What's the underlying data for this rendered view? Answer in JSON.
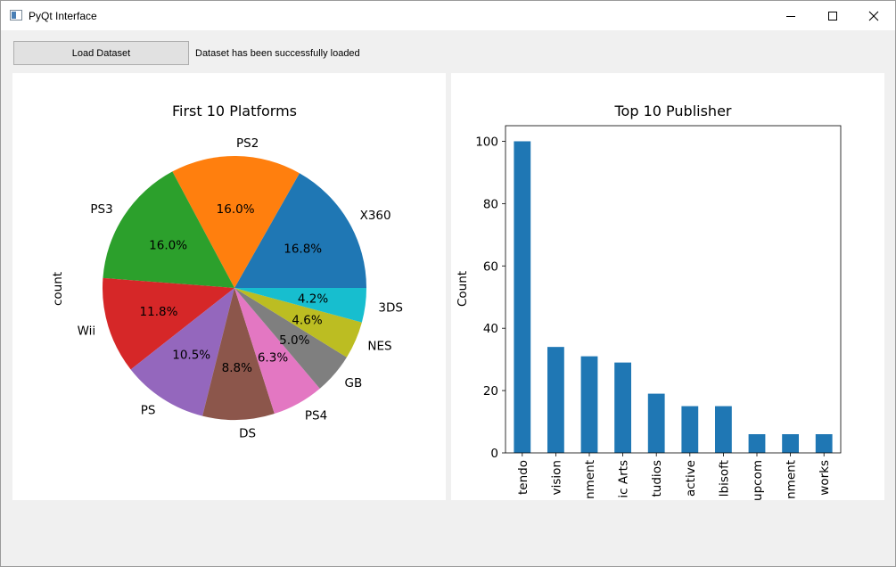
{
  "window": {
    "title": "PyQt Interface",
    "icons": {
      "app": "app-window-icon",
      "minimize": "minimize-icon",
      "maximize": "maximize-icon",
      "close": "close-icon"
    }
  },
  "toolbar": {
    "load_label": "Load Dataset",
    "status_text": "Dataset has been successfully loaded"
  },
  "chart_data": [
    {
      "type": "pie",
      "title": "First 10 Platforms",
      "ylabel": "count",
      "labels": [
        "X360",
        "PS2",
        "PS3",
        "Wii",
        "PS",
        "DS",
        "PS4",
        "GB",
        "NES",
        "3DS"
      ],
      "percent_labels": [
        "16.8%",
        "16.0%",
        "16.0%",
        "11.8%",
        "10.5%",
        "8.8%",
        "6.3%",
        "5.0%",
        "4.6%",
        "4.2%"
      ],
      "values": [
        16.8,
        16.0,
        16.0,
        11.8,
        10.5,
        8.8,
        6.3,
        5.0,
        4.6,
        4.2
      ],
      "colors": [
        "#1f77b4",
        "#ff7f0e",
        "#2ca02c",
        "#d62728",
        "#9467bd",
        "#8c564b",
        "#e377c2",
        "#7f7f7f",
        "#bcbd22",
        "#17becf"
      ]
    },
    {
      "type": "bar",
      "title": "Top 10 Publisher",
      "ylabel": "Count",
      "xlabel": "",
      "categories": [
        "tendo",
        "vision",
        "nment",
        "ic Arts",
        "tudios",
        "active",
        "lbisoft",
        "upcom",
        "nment",
        "works"
      ],
      "values": [
        100,
        34,
        31,
        29,
        19,
        15,
        15,
        6,
        6,
        6
      ],
      "ylim": [
        0,
        105
      ],
      "yticks": [
        "0",
        "20",
        "40",
        "60",
        "80",
        "100"
      ],
      "color": "#1f77b4"
    }
  ]
}
